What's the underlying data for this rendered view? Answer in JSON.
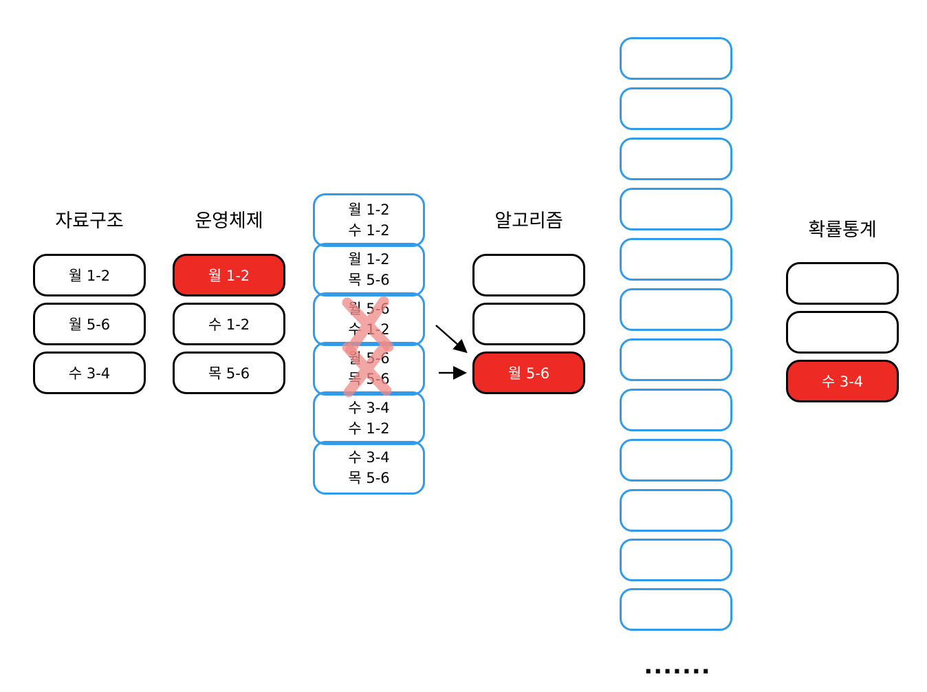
{
  "columns": {
    "data_structures": {
      "title": "자료구조",
      "items": [
        "월 1-2",
        "월 5-6",
        "수 3-4"
      ]
    },
    "operating_systems": {
      "title": "운영체제",
      "items": [
        "월 1-2",
        "수 1-2",
        "목 5-6"
      ],
      "selected_index": 0
    },
    "algorithms": {
      "title": "알고리즘",
      "items": [
        "",
        "",
        "월 5-6"
      ],
      "selected_index": 2
    },
    "probability_statistics": {
      "title": "확률통계",
      "items": [
        "",
        "",
        "수 3-4"
      ],
      "selected_index": 2
    }
  },
  "combinations": [
    {
      "line1": "월 1-2",
      "line2": "수 1-2",
      "crossed": false
    },
    {
      "line1": "월 1-2",
      "line2": "목 5-6",
      "crossed": false
    },
    {
      "line1": "월 5-6",
      "line2": "수 1-2",
      "crossed": true
    },
    {
      "line1": "월 5-6",
      "line2": "목 5-6",
      "crossed": true
    },
    {
      "line1": "수 3-4",
      "line2": "수 1-2",
      "crossed": false
    },
    {
      "line1": "수 3-4",
      "line2": "목 5-6",
      "crossed": false
    }
  ],
  "empty_slot_count": 12,
  "ellipsis": ".......",
  "colors": {
    "selected": "#ee2a24",
    "combo_border": "#2f9bea",
    "cross": "#f08a87"
  }
}
